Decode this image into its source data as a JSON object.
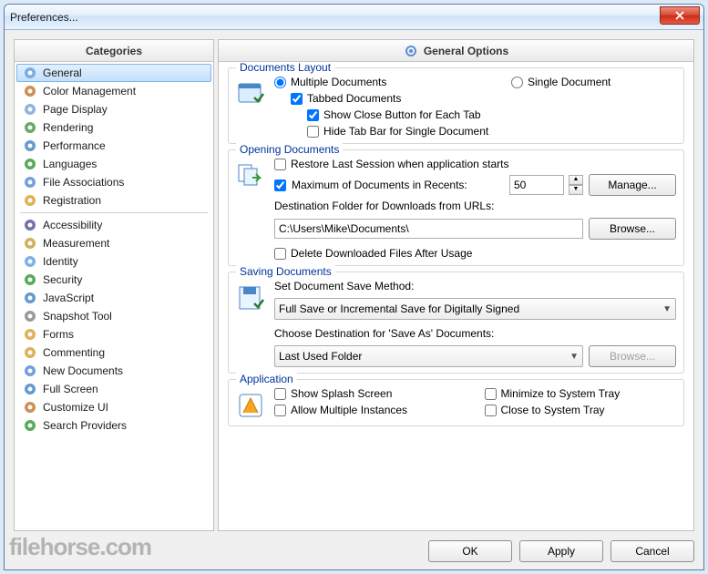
{
  "window": {
    "title": "Preferences..."
  },
  "panels": {
    "left_header": "Categories",
    "right_header": "General Options"
  },
  "categories": {
    "group1": [
      {
        "id": "general",
        "label": "General",
        "icon": "gear",
        "selected": true
      },
      {
        "id": "color",
        "label": "Color Management",
        "icon": "palette"
      },
      {
        "id": "pagedisplay",
        "label": "Page Display",
        "icon": "page"
      },
      {
        "id": "rendering",
        "label": "Rendering",
        "icon": "brush"
      },
      {
        "id": "performance",
        "label": "Performance",
        "icon": "gauge"
      },
      {
        "id": "languages",
        "label": "Languages",
        "icon": "globe"
      },
      {
        "id": "fileassoc",
        "label": "File Associations",
        "icon": "files"
      },
      {
        "id": "registration",
        "label": "Registration",
        "icon": "user"
      }
    ],
    "group2": [
      {
        "id": "accessibility",
        "label": "Accessibility",
        "icon": "access"
      },
      {
        "id": "measurement",
        "label": "Measurement",
        "icon": "ruler"
      },
      {
        "id": "identity",
        "label": "Identity",
        "icon": "id"
      },
      {
        "id": "security",
        "label": "Security",
        "icon": "shield"
      },
      {
        "id": "javascript",
        "label": "JavaScript",
        "icon": "js"
      },
      {
        "id": "snapshot",
        "label": "Snapshot Tool",
        "icon": "camera"
      },
      {
        "id": "forms",
        "label": "Forms",
        "icon": "form"
      },
      {
        "id": "commenting",
        "label": "Commenting",
        "icon": "comment"
      },
      {
        "id": "newdocs",
        "label": "New Documents",
        "icon": "newdoc"
      },
      {
        "id": "fullscreen",
        "label": "Full Screen",
        "icon": "fullscreen"
      },
      {
        "id": "customize",
        "label": "Customize UI",
        "icon": "customize"
      },
      {
        "id": "search",
        "label": "Search Providers",
        "icon": "search"
      }
    ]
  },
  "groups": {
    "layout": {
      "title": "Documents Layout",
      "multiple": "Multiple Documents",
      "single": "Single Document",
      "tabbed": "Tabbed Documents",
      "closebtn": "Show Close Button for Each Tab",
      "hidetab": "Hide Tab Bar for Single Document",
      "mode": "multiple",
      "tabbed_checked": true,
      "closebtn_checked": true,
      "hidetab_checked": false
    },
    "opening": {
      "title": "Opening Documents",
      "restore": "Restore Last Session when application starts",
      "restore_checked": false,
      "maxdocs": "Maximum of Documents in Recents:",
      "maxdocs_checked": true,
      "maxdocs_value": "50",
      "manage": "Manage...",
      "destlabel": "Destination Folder for Downloads from URLs:",
      "destpath": "C:\\Users\\Mike\\Documents\\",
      "browse": "Browse...",
      "deletedl": "Delete Downloaded Files After Usage",
      "deletedl_checked": false
    },
    "saving": {
      "title": "Saving Documents",
      "method_label": "Set Document Save Method:",
      "method_value": "Full Save or Incremental Save for Digitally Signed",
      "dest_label": "Choose Destination for 'Save As' Documents:",
      "dest_value": "Last Used Folder",
      "browse": "Browse..."
    },
    "application": {
      "title": "Application",
      "splash": "Show Splash Screen",
      "multiinst": "Allow Multiple Instances",
      "mintray": "Minimize to System Tray",
      "closetray": "Close to System Tray",
      "splash_checked": false,
      "multiinst_checked": false,
      "mintray_checked": false,
      "closetray_checked": false
    }
  },
  "buttons": {
    "ok": "OK",
    "apply": "Apply",
    "cancel": "Cancel"
  },
  "watermark": "filehorse.com"
}
